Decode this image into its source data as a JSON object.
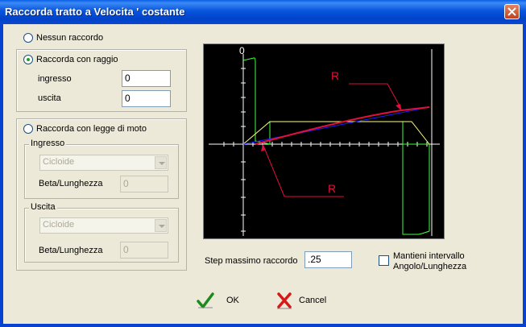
{
  "window": {
    "title": "Raccorda tratto a Velocita ' costante"
  },
  "options": {
    "none_label": "Nessun raccordo",
    "radius_label": "Raccorda con raggio",
    "law_label": "Raccorda con legge di moto",
    "selected": "radius"
  },
  "radius": {
    "ingresso_label": "ingresso",
    "ingresso_value": "0",
    "uscita_label": "uscita",
    "uscita_value": "0"
  },
  "law": {
    "ingresso_group": "Ingresso",
    "ingresso_select": "Cicloide",
    "ingresso_beta_label": "Beta/Lunghezza",
    "ingresso_beta_value": "0",
    "uscita_group": "Uscita",
    "uscita_select": "Cicloide",
    "uscita_beta_label": "Beta/Lunghezza",
    "uscita_beta_value": "0"
  },
  "graph": {
    "origin_label": "0",
    "r_label_top": "R",
    "r_label_bottom": "R",
    "colors": {
      "speed": "#ffff80",
      "accel": "#40ff40",
      "line": "#2020ff",
      "radius": "#e0103a",
      "axis": "#ffffff"
    }
  },
  "step": {
    "label": "Step massimo raccordo",
    "value": ".25"
  },
  "keep_interval": {
    "label_line1": "Mantieni intervallo",
    "label_line2": "Angolo/Lunghezza",
    "checked": false
  },
  "buttons": {
    "ok_label": "OK",
    "cancel_label": "Cancel"
  }
}
